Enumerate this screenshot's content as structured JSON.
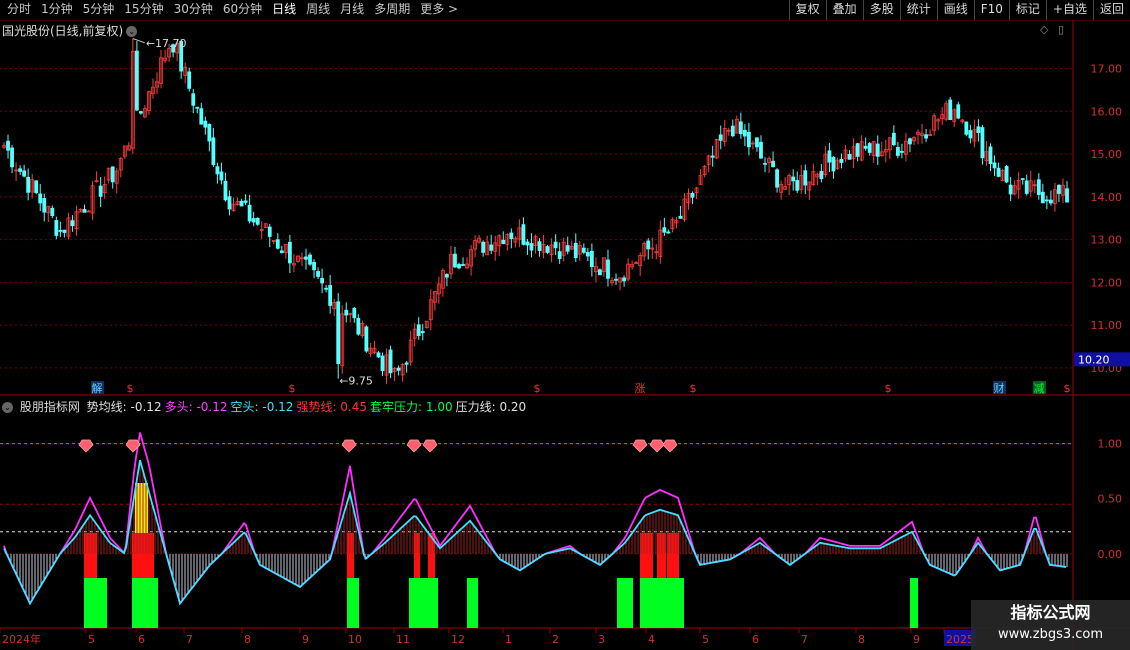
{
  "toolbar": {
    "periods": [
      "分时",
      "1分钟",
      "5分钟",
      "15分钟",
      "30分钟",
      "60分钟",
      "日线",
      "周线",
      "月线",
      "多周期",
      "更多 >"
    ],
    "active_period": "日线",
    "actions": [
      "复权",
      "叠加",
      "多股",
      "统计",
      "画线",
      "F10",
      "标记",
      "+自选",
      "返回"
    ]
  },
  "main": {
    "title": "国光股份(日线,前复权)",
    "price_ticks": [
      "17.00",
      "16.00",
      "15.00",
      "14.00",
      "13.00",
      "12.00",
      "11.00",
      "10.00"
    ],
    "current_price": "10.20",
    "high_label": "17.70",
    "low_label": "9.75",
    "markers": [
      {
        "text": "解",
        "color": "#5fd0ff",
        "month_pos": 0.5
      },
      {
        "text": "$",
        "color": "#ff3030"
      },
      {
        "text": "$",
        "color": "#ff3030"
      },
      {
        "text": "$",
        "color": "#ff3030"
      },
      {
        "text": "涨",
        "color": "#ff3030"
      },
      {
        "text": "$",
        "color": "#ff3030"
      },
      {
        "text": "$",
        "color": "#ff3030"
      },
      {
        "text": "财",
        "color": "#5fd0ff"
      },
      {
        "text": "减",
        "color": "#00ff40"
      },
      {
        "text": "$",
        "color": "#ff3030"
      }
    ]
  },
  "indicator": {
    "name": "股朋指标网",
    "items": [
      {
        "label": "势均线:",
        "value": "-0.12",
        "color": "#e0e0e0"
      },
      {
        "label": "多头:",
        "value": "-0.12",
        "color": "#ff40ff"
      },
      {
        "label": "空头:",
        "value": "-0.12",
        "color": "#40e0ff"
      },
      {
        "label": "强势线:",
        "value": "0.45",
        "color": "#ff3030"
      },
      {
        "label": "套牢压力:",
        "value": "1.00",
        "color": "#00ff40"
      },
      {
        "label": "压力线:",
        "value": "0.20",
        "color": "#e0e0e0"
      }
    ],
    "y_ticks": [
      "1.00",
      "0.50",
      "0.00"
    ]
  },
  "x_axis": {
    "labels": [
      "2024年",
      "5",
      "6",
      "7",
      "8",
      "9",
      "10",
      "11",
      "12",
      "1",
      "2",
      "3",
      "4",
      "5",
      "6",
      "7",
      "8",
      "9",
      "2025"
    ]
  },
  "watermark": {
    "line1": "指标公式网",
    "line2": "www.zbgs3.com"
  },
  "chart_data": {
    "type": "candlestick",
    "title": "国光股份(日线,前复权)",
    "y_range_price": [
      9.6,
      17.9
    ],
    "y_range_indicator": [
      -0.6,
      1.35
    ],
    "price_path_keypoints": [
      {
        "x": "2024-04",
        "close": 15.2
      },
      {
        "x": "2024-04-mid",
        "close": 13.2
      },
      {
        "x": "2024-05",
        "close": 14.6
      },
      {
        "x": "2024-06",
        "close": 17.7
      },
      {
        "x": "2024-07",
        "close": 14.0
      },
      {
        "x": "2024-08",
        "close": 12.8
      },
      {
        "x": "2024-09",
        "close": 11.5
      },
      {
        "x": "2024-10",
        "close": 9.75
      },
      {
        "x": "2024-11",
        "close": 12.5
      },
      {
        "x": "2024-12",
        "close": 13.2
      },
      {
        "x": "2025-01",
        "close": 12.8
      },
      {
        "x": "2025-02",
        "close": 12.2
      },
      {
        "x": "2025-03",
        "close": 13.3
      },
      {
        "x": "2025-04",
        "close": 15.7
      },
      {
        "x": "2025-05",
        "close": 14.2
      },
      {
        "x": "2025-06",
        "close": 15.0
      },
      {
        "x": "2025-07",
        "close": 15.2
      },
      {
        "x": "2025-08",
        "close": 16.1
      },
      {
        "x": "2025-09",
        "close": 14.2
      },
      {
        "x": "2025-10",
        "close": 14.0
      }
    ]
  }
}
